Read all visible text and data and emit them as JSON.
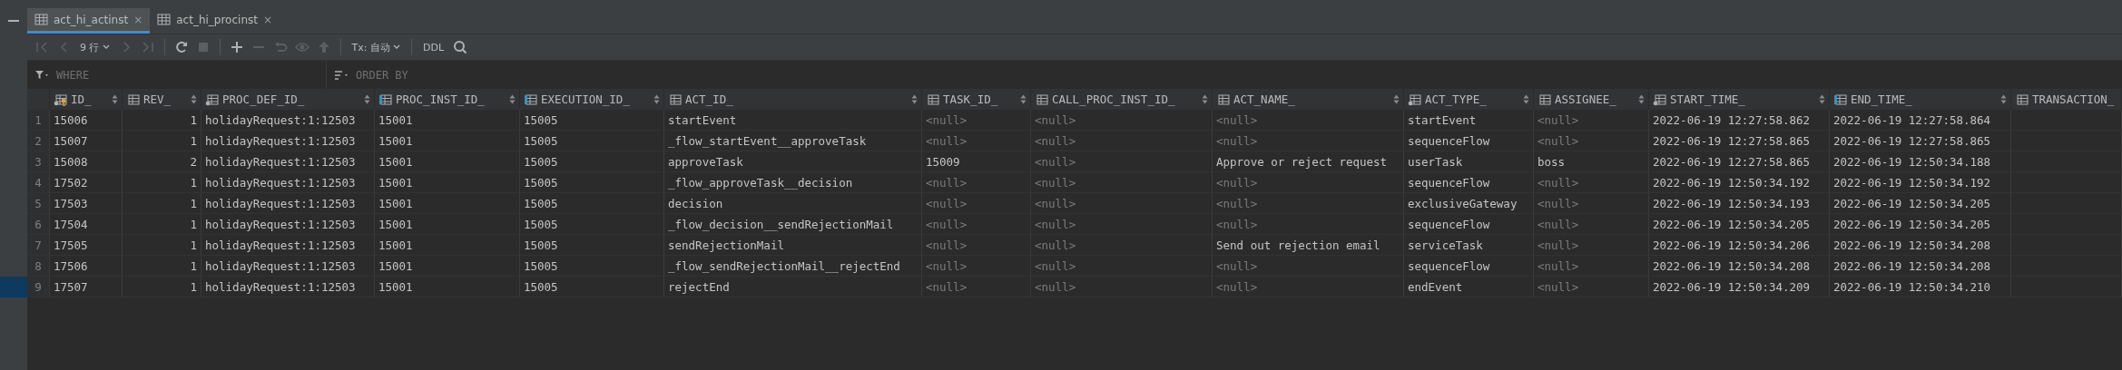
{
  "tabs": [
    {
      "label": "act_hi_actinst",
      "selected": true,
      "close": "×"
    },
    {
      "label": "act_hi_procinst",
      "selected": false,
      "close": "×"
    }
  ],
  "toolbar": [
    {
      "kind": "first",
      "disabled": true
    },
    {
      "kind": "prev",
      "disabled": true
    },
    {
      "kind": "rows",
      "label": "9 行"
    },
    {
      "kind": "next",
      "disabled": true
    },
    {
      "kind": "last",
      "disabled": true
    },
    {
      "kind": "sep"
    },
    {
      "kind": "refresh",
      "disabled": false
    },
    {
      "kind": "stop",
      "disabled": true
    },
    {
      "kind": "sep"
    },
    {
      "kind": "add",
      "disabled": false
    },
    {
      "kind": "remove",
      "disabled": true
    },
    {
      "kind": "revert",
      "disabled": true
    },
    {
      "kind": "preview",
      "disabled": true
    },
    {
      "kind": "submit",
      "disabled": true
    },
    {
      "kind": "sep"
    },
    {
      "kind": "tx",
      "label": "Tx: 自动"
    },
    {
      "kind": "sep"
    },
    {
      "kind": "ddl",
      "label": "DDL"
    },
    {
      "kind": "search",
      "disabled": false
    }
  ],
  "filter": {
    "where_placeholder": "WHERE",
    "order_placeholder": "ORDER BY"
  },
  "table": {
    "columns": [
      {
        "label": "ID_",
        "kind": "key",
        "sortable": true
      },
      {
        "label": "REV_",
        "kind": "plain",
        "sortable": true
      },
      {
        "label": "PROC_DEF_ID_",
        "kind": "dot",
        "sortable": true
      },
      {
        "label": "PROC_INST_ID_",
        "kind": "marker",
        "sortable": true
      },
      {
        "label": "EXECUTION_ID_",
        "kind": "marker",
        "sortable": true
      },
      {
        "label": "ACT_ID_",
        "kind": "plain",
        "sortable": true
      },
      {
        "label": "TASK_ID_",
        "kind": "plain",
        "sortable": true
      },
      {
        "label": "CALL_PROC_INST_ID_",
        "kind": "plain",
        "sortable": true
      },
      {
        "label": "ACT_NAME_",
        "kind": "plain",
        "sortable": true
      },
      {
        "label": "ACT_TYPE_",
        "kind": "dot",
        "sortable": true
      },
      {
        "label": "ASSIGNEE_",
        "kind": "plain",
        "sortable": true
      },
      {
        "label": "START_TIME_",
        "kind": "dot",
        "sortable": true
      },
      {
        "label": "END_TIME_",
        "kind": "marker",
        "sortable": true
      },
      {
        "label": "TRANSACTION_",
        "kind": "plain",
        "sortable": false
      }
    ],
    "rows": [
      {
        "number": "1",
        "selected": false,
        "cells": [
          "15006",
          "1",
          "holidayRequest:1:12503",
          "15001",
          "15005",
          "startEvent",
          {
            "null": true,
            "text": "<null>"
          },
          {
            "null": true,
            "text": "<null>"
          },
          {
            "null": true,
            "text": "<null>"
          },
          "startEvent",
          {
            "null": true,
            "text": "<null>"
          },
          "2022-06-19 12:27:58.862",
          "2022-06-19 12:27:58.864"
        ]
      },
      {
        "number": "2",
        "selected": false,
        "cells": [
          "15007",
          "1",
          "holidayRequest:1:12503",
          "15001",
          "15005",
          "_flow_startEvent__approveTask",
          {
            "null": true,
            "text": "<null>"
          },
          {
            "null": true,
            "text": "<null>"
          },
          {
            "null": true,
            "text": "<null>"
          },
          "sequenceFlow",
          {
            "null": true,
            "text": "<null>"
          },
          "2022-06-19 12:27:58.865",
          "2022-06-19 12:27:58.865"
        ]
      },
      {
        "number": "3",
        "selected": false,
        "cells": [
          "15008",
          "2",
          "holidayRequest:1:12503",
          "15001",
          "15005",
          "approveTask",
          "15009",
          {
            "null": true,
            "text": "<null>"
          },
          "Approve or reject request",
          "userTask",
          "boss",
          "2022-06-19 12:27:58.865",
          "2022-06-19 12:50:34.188"
        ]
      },
      {
        "number": "4",
        "selected": false,
        "cells": [
          "17502",
          "1",
          "holidayRequest:1:12503",
          "15001",
          "15005",
          "_flow_approveTask__decision",
          {
            "null": true,
            "text": "<null>"
          },
          {
            "null": true,
            "text": "<null>"
          },
          {
            "null": true,
            "text": "<null>"
          },
          "sequenceFlow",
          {
            "null": true,
            "text": "<null>"
          },
          "2022-06-19 12:50:34.192",
          "2022-06-19 12:50:34.192"
        ]
      },
      {
        "number": "5",
        "selected": false,
        "cells": [
          "17503",
          "1",
          "holidayRequest:1:12503",
          "15001",
          "15005",
          "decision",
          {
            "null": true,
            "text": "<null>"
          },
          {
            "null": true,
            "text": "<null>"
          },
          {
            "null": true,
            "text": "<null>"
          },
          "exclusiveGateway",
          {
            "null": true,
            "text": "<null>"
          },
          "2022-06-19 12:50:34.193",
          "2022-06-19 12:50:34.205"
        ]
      },
      {
        "number": "6",
        "selected": false,
        "cells": [
          "17504",
          "1",
          "holidayRequest:1:12503",
          "15001",
          "15005",
          "_flow_decision__sendRejectionMail",
          {
            "null": true,
            "text": "<null>"
          },
          {
            "null": true,
            "text": "<null>"
          },
          {
            "null": true,
            "text": "<null>"
          },
          "sequenceFlow",
          {
            "null": true,
            "text": "<null>"
          },
          "2022-06-19 12:50:34.205",
          "2022-06-19 12:50:34.205"
        ]
      },
      {
        "number": "7",
        "selected": false,
        "cells": [
          "17505",
          "1",
          "holidayRequest:1:12503",
          "15001",
          "15005",
          "sendRejectionMail",
          {
            "null": true,
            "text": "<null>"
          },
          {
            "null": true,
            "text": "<null>"
          },
          "Send out rejection email",
          "serviceTask",
          {
            "null": true,
            "text": "<null>"
          },
          "2022-06-19 12:50:34.206",
          "2022-06-19 12:50:34.208"
        ]
      },
      {
        "number": "8",
        "selected": false,
        "cells": [
          "17506",
          "1",
          "holidayRequest:1:12503",
          "15001",
          "15005",
          "_flow_sendRejectionMail__rejectEnd",
          {
            "null": true,
            "text": "<null>"
          },
          {
            "null": true,
            "text": "<null>"
          },
          {
            "null": true,
            "text": "<null>"
          },
          "sequenceFlow",
          {
            "null": true,
            "text": "<null>"
          },
          "2022-06-19 12:50:34.208",
          "2022-06-19 12:50:34.208"
        ]
      },
      {
        "number": "9",
        "selected": true,
        "cells": [
          "17507",
          "1",
          "holidayRequest:1:12503",
          "15001",
          "15005",
          "rejectEnd",
          {
            "null": true,
            "text": "<null>"
          },
          {
            "null": true,
            "text": "<null>"
          },
          {
            "null": true,
            "text": "<null>"
          },
          "endEvent",
          {
            "null": true,
            "text": "<null>"
          },
          "2022-06-19 12:50:34.209",
          "2022-06-19 12:50:34.210"
        ]
      }
    ]
  }
}
